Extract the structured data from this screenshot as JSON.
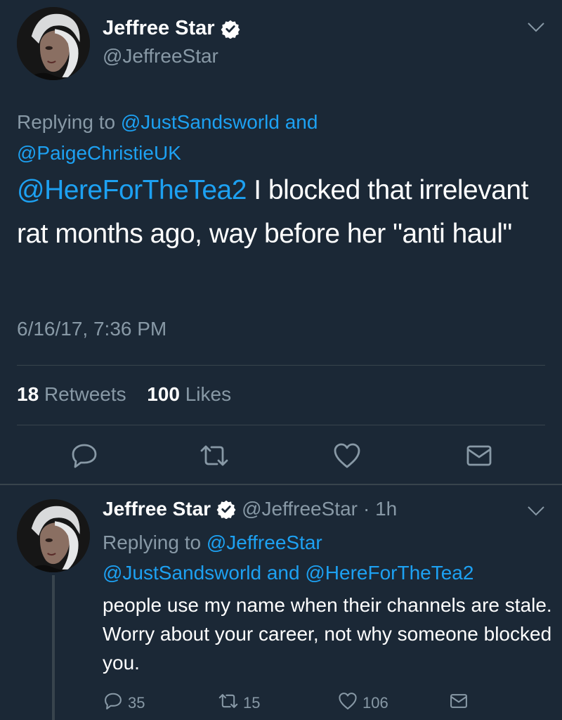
{
  "main_tweet": {
    "display_name": "Jeffree Star",
    "handle": "@JeffreeStar",
    "replying_prefix": "Replying to ",
    "replying_user1": "@JustSandsworld",
    "replying_and": " and",
    "replying_user2": "@PaigeChristieUK",
    "mention": "@HereForTheTea2",
    "text": " I blocked that irrelevant rat months ago, way before her \"anti haul\"",
    "timestamp": "6/16/17, 7:36 PM",
    "retweets_count": "18",
    "retweets_label": "Retweets",
    "likes_count": "100",
    "likes_label": "Likes",
    "icons": [
      "verified-badge",
      "chevron-down",
      "reply",
      "retweet",
      "like",
      "direct-message"
    ]
  },
  "reply_tweet": {
    "display_name": "Jeffree Star",
    "handle": "@JeffreeStar",
    "time": "· 1h",
    "replying_prefix": "Replying to ",
    "replying_user1": "@JeffreeStar",
    "replying_user2": "@JustSandsworld",
    "replying_and": " and ",
    "replying_user3": "@HereForTheTea2",
    "text": "people use my name when their channels are stale. Worry about your career, not why someone blocked you.",
    "reply_count": "35",
    "retweet_count": "15",
    "like_count": "106"
  },
  "colors": {
    "background": "#1b2836",
    "link": "#1da1f2",
    "secondary_text": "#8899a6",
    "divider": "#38444d"
  }
}
